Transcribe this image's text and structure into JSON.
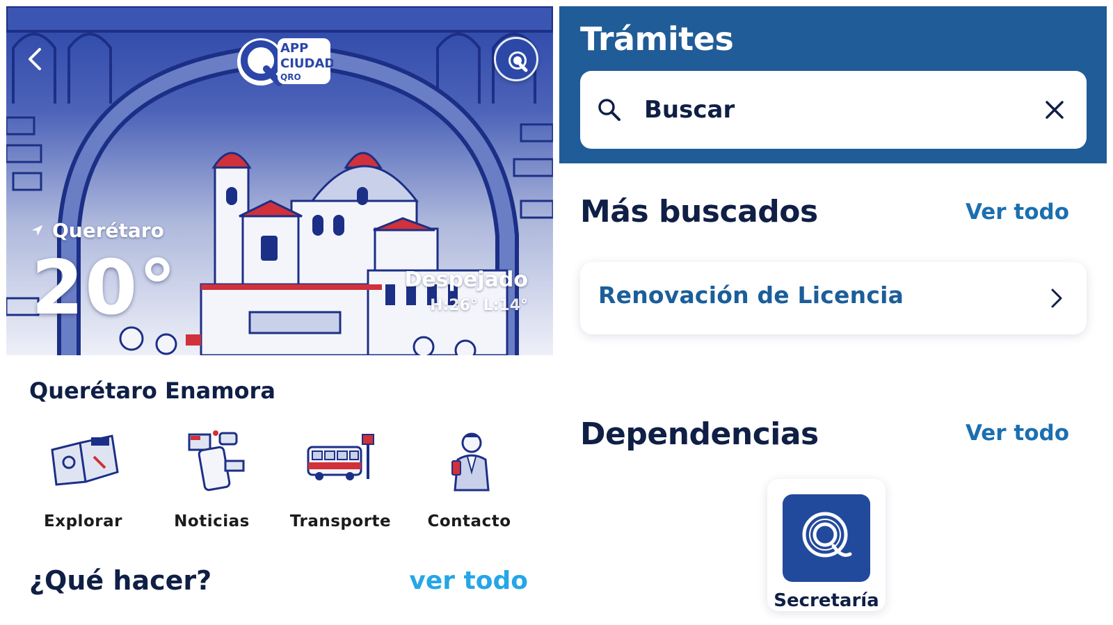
{
  "left_screen": {
    "header": {
      "back_icon": "chevron-left-icon",
      "logo_text": [
        "APP",
        "CIUDAD",
        "QRO"
      ],
      "profile_icon": "q-logo-icon"
    },
    "weather": {
      "location": "Querétaro",
      "location_icon": "location-arrow-icon",
      "temperature": "20°",
      "condition": "Despejado",
      "range": "H:26° L:14°"
    },
    "section_title": "Querétaro Enamora",
    "shortcuts": [
      {
        "label": "Explorar",
        "icon": "map-icon"
      },
      {
        "label": "Noticias",
        "icon": "news-phone-icon"
      },
      {
        "label": "Transporte",
        "icon": "bus-icon"
      },
      {
        "label": "Contacto",
        "icon": "person-phone-icon"
      }
    ],
    "what_to_do": {
      "title": "¿Qué hacer?",
      "see_all": "ver todo"
    }
  },
  "right_screen": {
    "title": "Trámites",
    "search": {
      "placeholder": "Buscar",
      "search_icon": "search-icon",
      "clear_icon": "close-icon"
    },
    "most_searched": {
      "title": "Más buscados",
      "see_all": "Ver todo",
      "items": [
        {
          "label": "Renovación de Licencia",
          "icon": "chevron-right-icon"
        }
      ]
    },
    "dependencies": {
      "title": "Dependencias",
      "see_all": "Ver todo",
      "items": [
        {
          "label": "Secretaría",
          "icon": "q-logo-icon"
        }
      ]
    }
  },
  "colors": {
    "header_blue": "#205c97",
    "link_light_blue": "#25a6e6",
    "link_blue": "#1b6fb0",
    "dark_navy": "#0f1f45",
    "hero_blue": "#2b46a8",
    "accent_red": "#d0313b"
  }
}
